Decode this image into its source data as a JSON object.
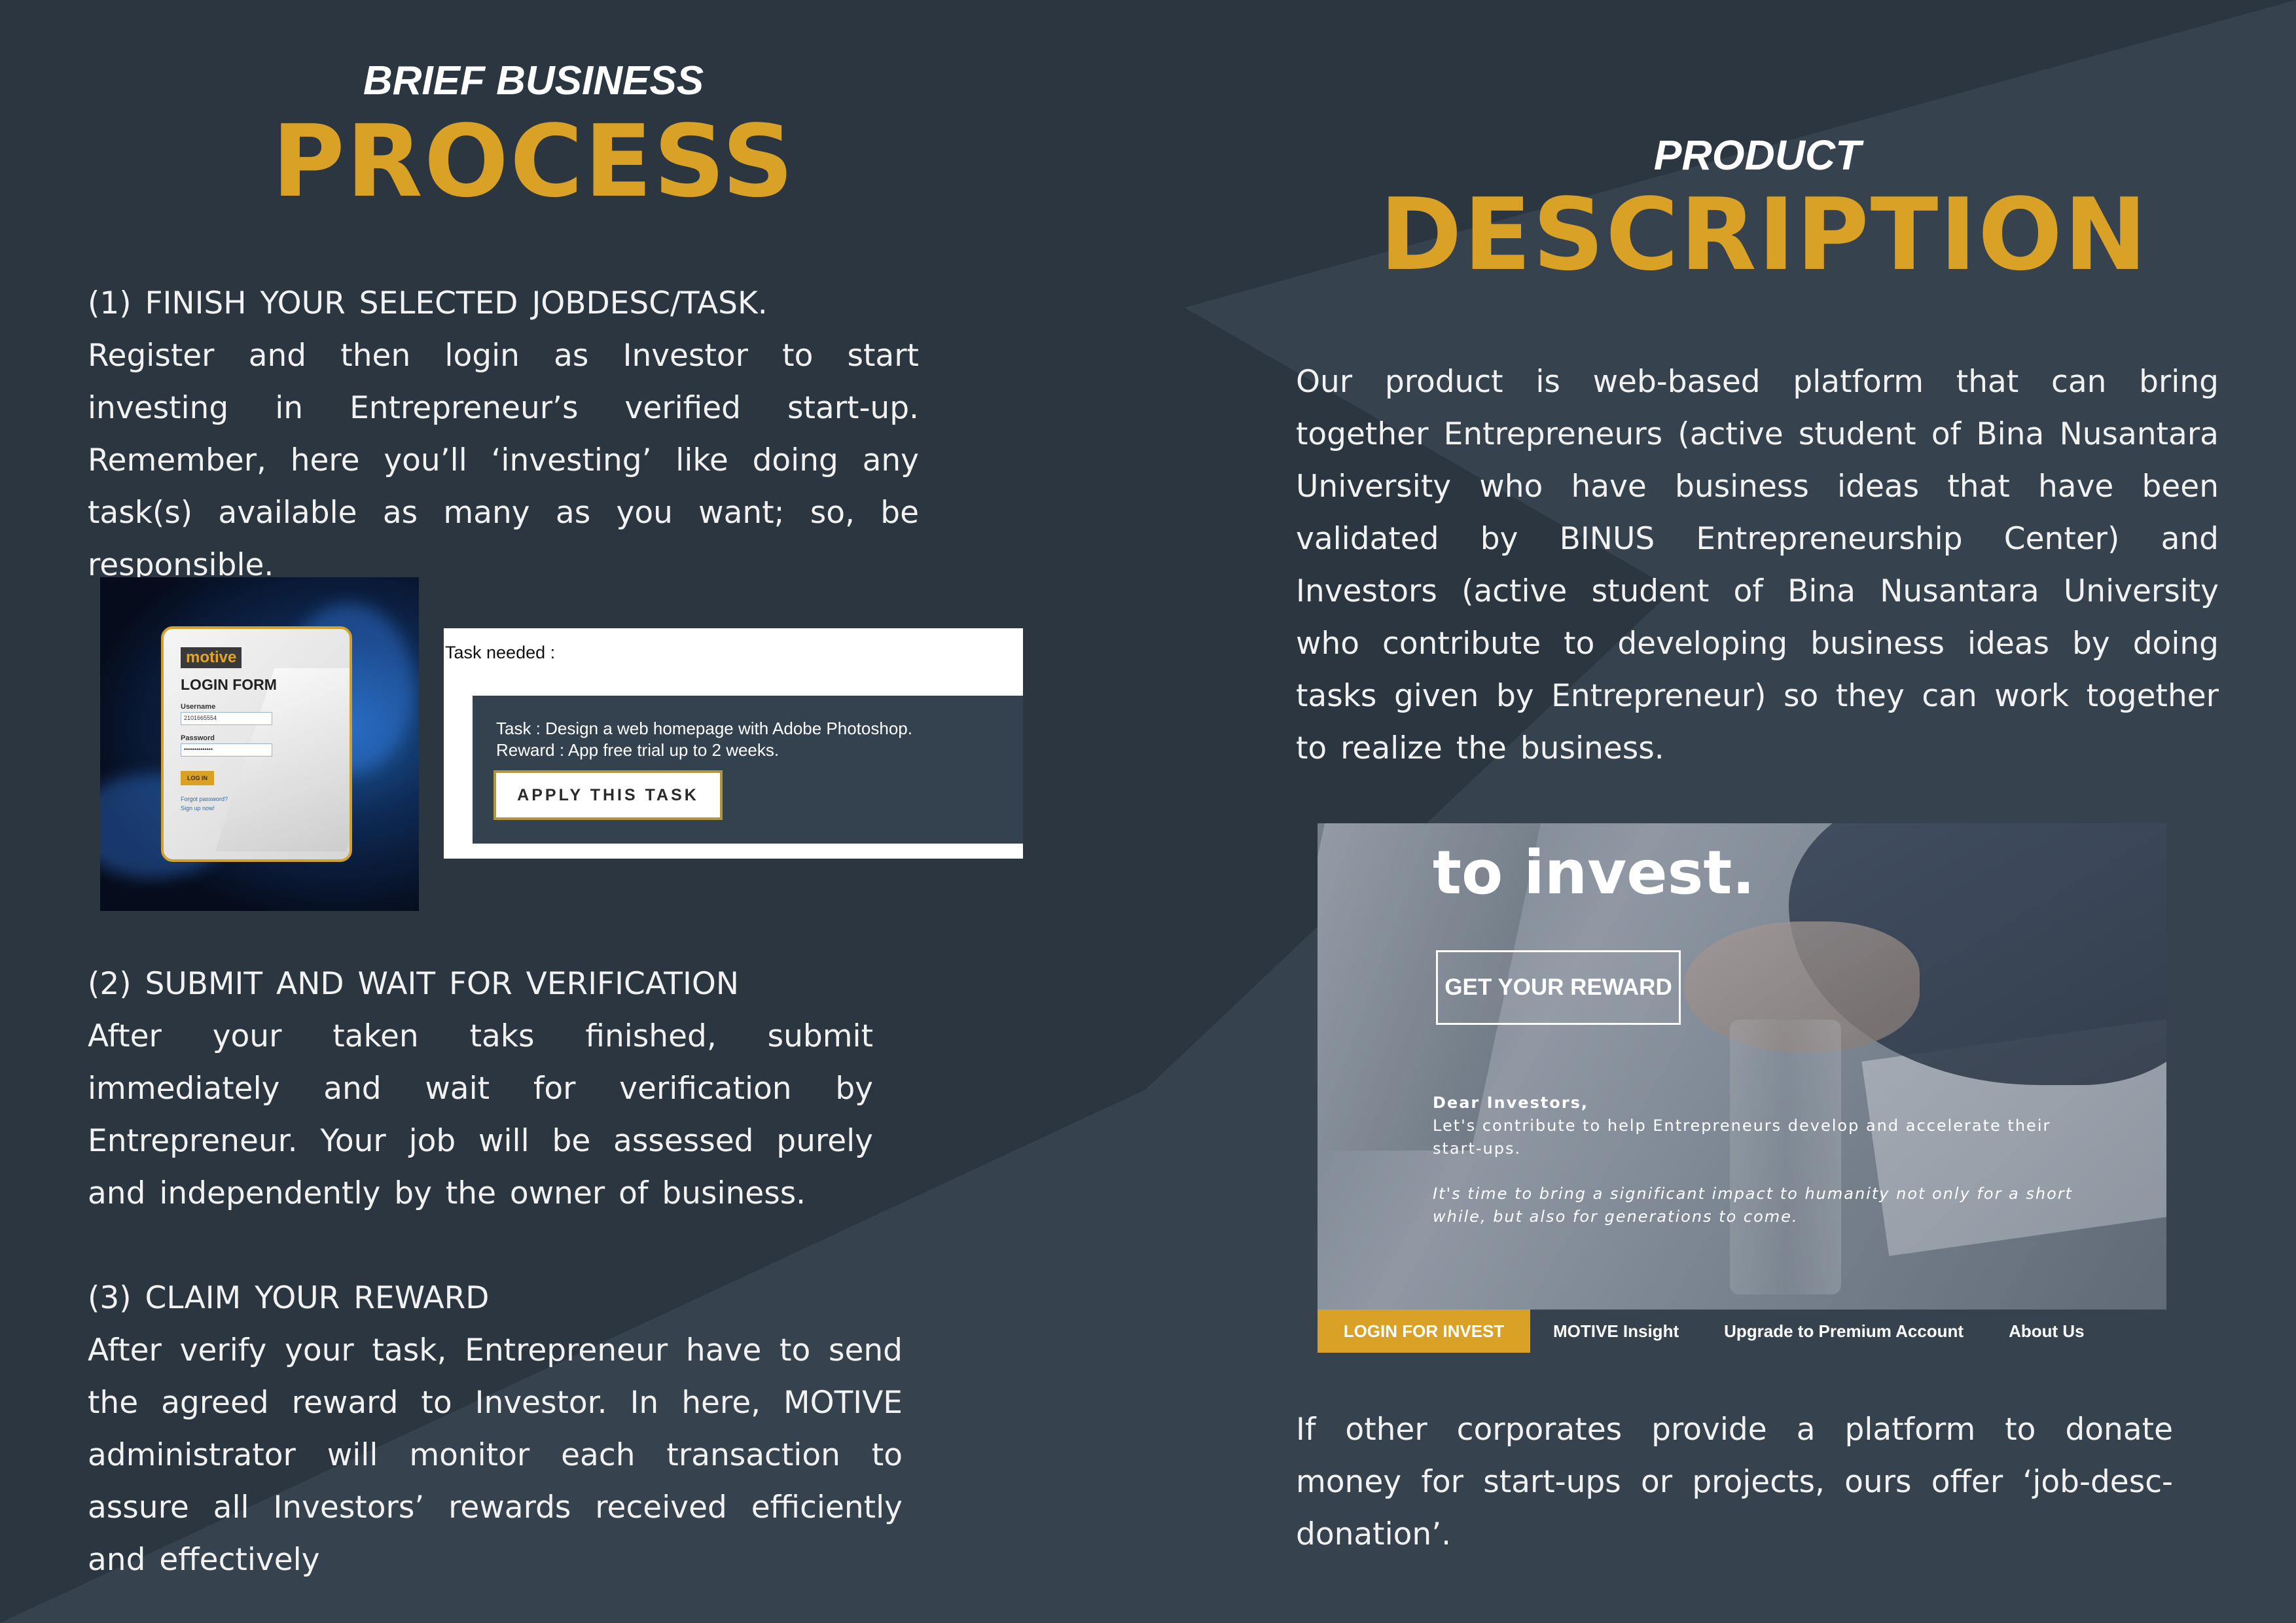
{
  "colors": {
    "background_dark": "#2b3640",
    "background_light": "#36434f",
    "accent_gold": "#d9a227",
    "text": "#ffffff"
  },
  "left": {
    "heading_small": "BRIEF BUSINESS",
    "heading_big": "PROCESS",
    "step1": "(1) FINISH YOUR SELECTED JOBDESC/TASK.\nRegister and then login as Investor to start investing in Entrepreneur’s verified start-up. Remember, here you’ll ‘investing’ like doing any task(s) available as many as you want; so, be responsible.",
    "step2": "(2) SUBMIT AND WAIT FOR VERIFICATION\nAfter your taken taks finished, submit immediately and wait for verification by Entrepreneur. Your job will be assessed purely and independently by the owner of business.",
    "step3": "(3) CLAIM YOUR REWARD\nAfter verify your task, Entrepreneur have to send the agreed reward to Investor. In here, MOTIVE administrator will monitor each transaction to assure all Investors’ rewards received efficiently and effectively"
  },
  "login_form": {
    "brand": "motive",
    "title": "LOGIN FORM",
    "username_label": "Username",
    "username_value": "2101665554",
    "password_label": "Password",
    "password_value": "••••••••••••••",
    "button": "LOG IN",
    "forgot": "Forgot password?",
    "signup": "Sign up now!"
  },
  "task_card": {
    "label": "Task needed :",
    "task": "Task : Design a web homepage with Adobe Photoshop.",
    "reward": "Reward : App free trial up to 2 weeks.",
    "button": "APPLY THIS TASK"
  },
  "right": {
    "heading_small": "PRODUCT",
    "heading_big": "DESCRIPTION",
    "description": "Our product is web-based platform that can bring together Entrepreneurs (active student of Bina Nusantara University who have business ideas that have been validated by BINUS Entrepreneurship Center) and Investors (active student of Bina Nusantara University who contribute to developing business ideas by doing tasks given by Entrepreneur) so they can work together to realize the business.",
    "closing": "If other corporates provide a platform to donate money for start-ups or projects, ours offer ‘job-desc-donation’."
  },
  "website": {
    "headline": "to invest.",
    "cta": "GET YOUR REWARD",
    "greeting": "Dear Investors,",
    "message": "Let's contribute to help Entrepreneurs develop and accelerate their start-ups.",
    "italic_message": "It's time to bring a significant impact to humanity not only for a short while, but also for generations to come.",
    "nav": [
      "LOGIN FOR INVEST",
      "MOTIVE Insight",
      "Upgrade to Premium Account",
      "About Us"
    ]
  }
}
